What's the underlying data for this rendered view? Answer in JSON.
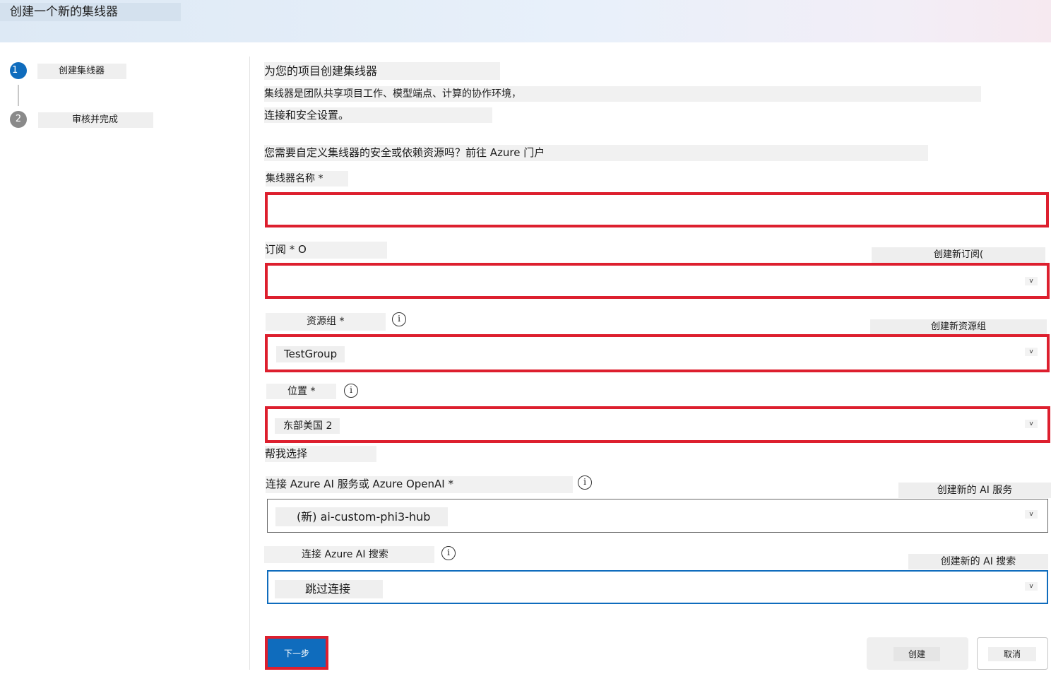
{
  "window": {
    "title": "创建一个新的集线器"
  },
  "steps": [
    {
      "number": "1",
      "label": "创建集线器"
    },
    {
      "number": "2",
      "label": "审核并完成"
    }
  ],
  "intro": {
    "heading": "为您的项目创建集线器",
    "desc_line1": "集线器是团队共享项目工作、模型端点、计算的协作环境，",
    "desc_line2": "连接和安全设置。",
    "custom_prompt": "您需要自定义集线器的安全或依赖资源吗？前往 Azure 门户"
  },
  "form": {
    "hub_name": {
      "label": "集线器名称 *",
      "value": ""
    },
    "subscription": {
      "label": "订阅 * O",
      "value": "",
      "create_link": "创建新订阅("
    },
    "resource_group": {
      "label": "资源组 *",
      "value": "TestGroup",
      "create_link": "创建新资源组"
    },
    "location": {
      "label": "位置 *",
      "value": "东部美国 2",
      "help_link": "帮我选择"
    },
    "ai_service": {
      "label": "连接 Azure AI 服务或 Azure OpenAI *",
      "value": "(新) ai-custom-phi3-hub",
      "create_link": "创建新的 AI 服务"
    },
    "ai_search": {
      "label": "连接 Azure AI 搜索",
      "value": "跳过连接",
      "create_link": "创建新的 AI 搜索"
    },
    "chevron": "v",
    "info_glyph": "i"
  },
  "footer": {
    "next": "下一步",
    "create": "创建",
    "cancel": "取消"
  },
  "colors": {
    "accent": "#0f6cbd",
    "highlight": "#dd1f2e"
  }
}
